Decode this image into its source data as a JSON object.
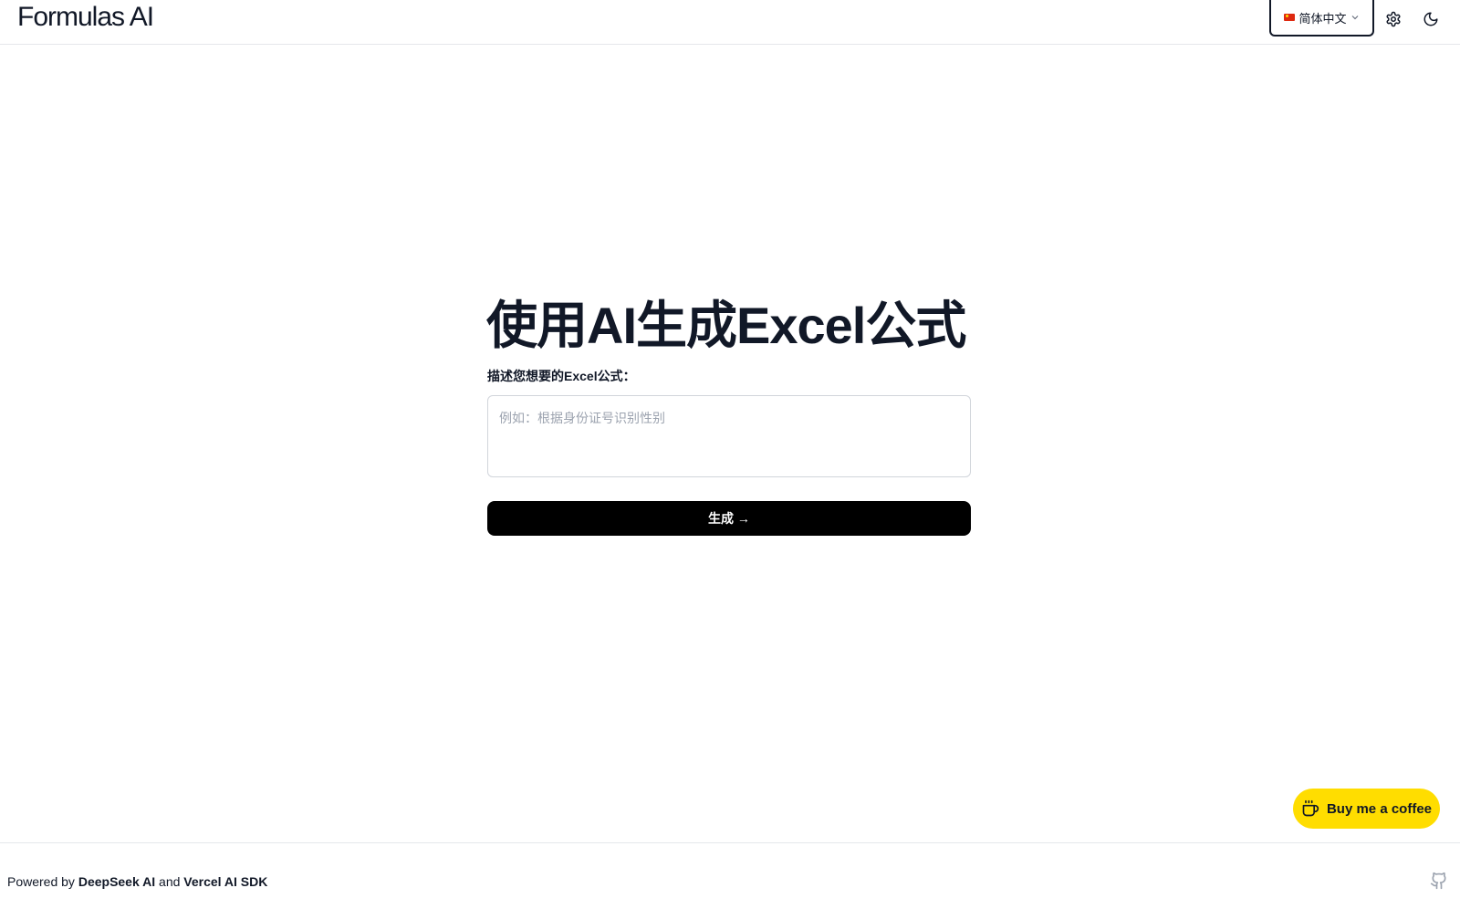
{
  "header": {
    "logo": "Formulas AI",
    "language": "简体中文"
  },
  "main": {
    "title": "使用AI生成Excel公式",
    "input_label": "描述您想要的Excel公式：",
    "input_placeholder": "例如：根据身份证号识别性别",
    "input_value": "",
    "generate_label": "生成 →"
  },
  "coffee": {
    "label": "Buy me a coffee"
  },
  "footer": {
    "powered_prefix": "Powered by",
    "deepseek": "DeepSeek AI",
    "and": "and",
    "vercel": "Vercel AI SDK"
  },
  "icons": {
    "flag": "china-flag-icon",
    "chevron": "chevron-down-icon",
    "settings": "gear-icon",
    "theme": "moon-icon",
    "coffee": "coffee-cup-icon",
    "github": "github-icon"
  },
  "colors": {
    "coffee_bg": "#ffdd00",
    "primary_button": "#000000"
  }
}
